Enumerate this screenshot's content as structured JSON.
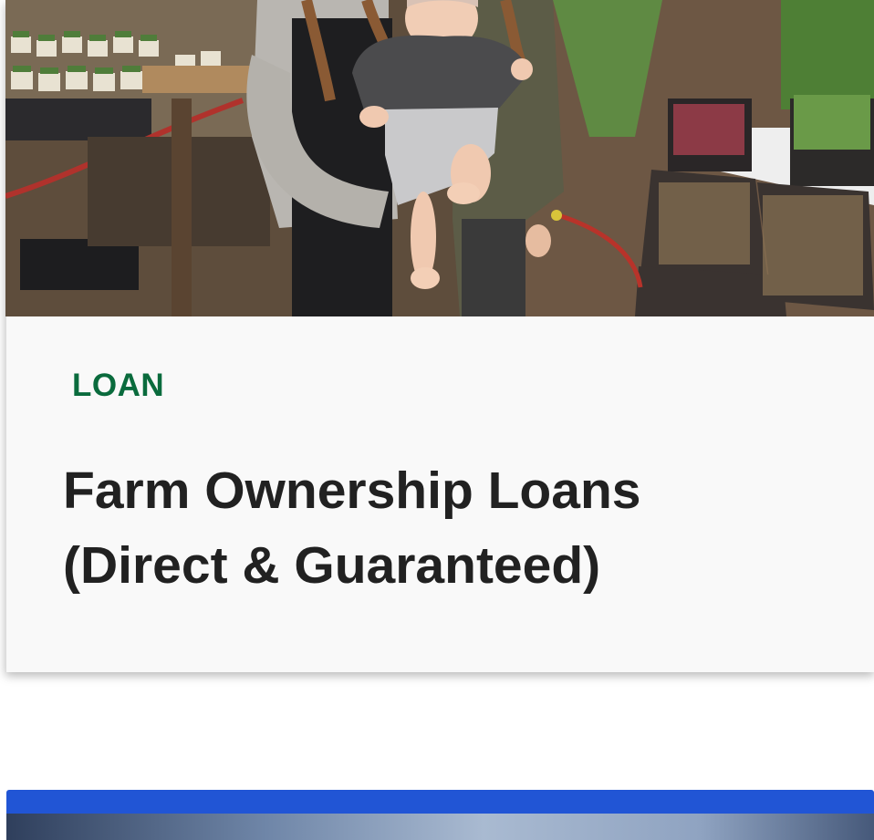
{
  "cards": [
    {
      "tag": "LOAN",
      "title": "Farm Ownership Loans (Direct & Guaranteed)",
      "photo": "photo-family-in-greenhouse",
      "tag_color": "#0a6b3d"
    }
  ],
  "next_card": {
    "accent_color": "#2155d5"
  }
}
